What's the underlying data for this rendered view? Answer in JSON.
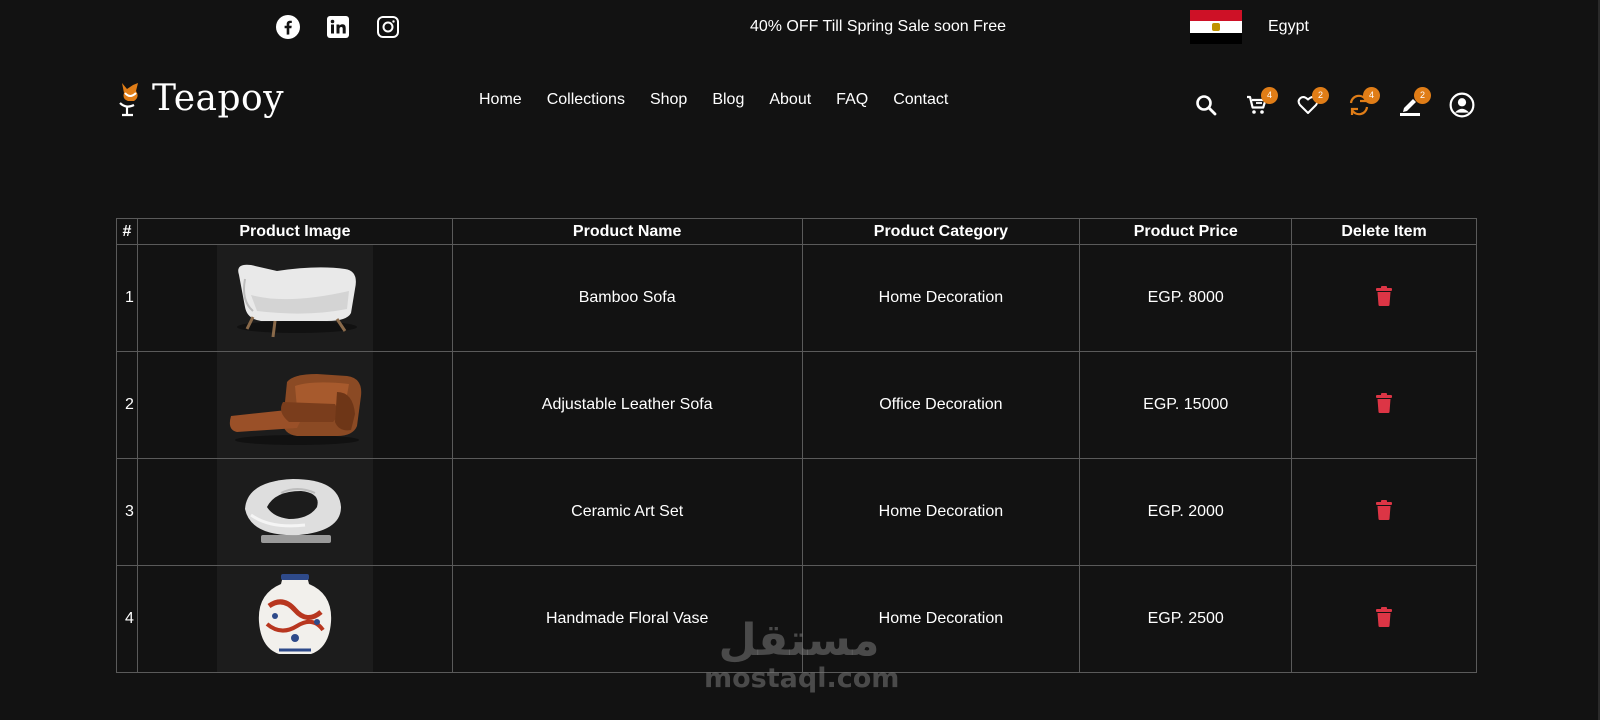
{
  "topbar": {
    "social": [
      "facebook-icon",
      "linkedin-icon",
      "instagram-icon"
    ],
    "promo": "40% OFF Till Spring Sale soon Free",
    "country": "Egypt"
  },
  "header": {
    "logo_text": "Teapoy",
    "nav": [
      "Home",
      "Collections",
      "Shop",
      "Blog",
      "About",
      "FAQ",
      "Contact"
    ],
    "icons": {
      "search": "search-icon",
      "cart": {
        "icon": "cart-icon",
        "count": "4"
      },
      "wishlist": {
        "icon": "heart-icon",
        "count": "2"
      },
      "compare": {
        "icon": "compare-icon",
        "count": "4"
      },
      "edit": {
        "icon": "edit-icon",
        "count": "2"
      },
      "account": "user-icon"
    },
    "accent_color": "#e07d17"
  },
  "table": {
    "headers": [
      "#",
      "Product Image",
      "Product Name",
      "Product Category",
      "Product Price",
      "Delete Item"
    ],
    "rows": [
      {
        "num": "1",
        "image": "white-armchair",
        "name": "Bamboo Sofa",
        "category": "Home Decoration",
        "price": "EGP. 8000"
      },
      {
        "num": "2",
        "image": "leather-recliner",
        "name": "Adjustable Leather Sofa",
        "category": "Office Decoration",
        "price": "EGP. 15000"
      },
      {
        "num": "3",
        "image": "ceramic-sculpture",
        "name": "Ceramic Art Set",
        "category": "Home Decoration",
        "price": "EGP. 2000"
      },
      {
        "num": "4",
        "image": "floral-vase",
        "name": "Handmade Floral Vase",
        "category": "Home Decoration",
        "price": "EGP. 2500"
      }
    ],
    "delete_color": "#dc3545"
  },
  "watermark": {
    "arabic": "مستقل",
    "latin": "mostaql.com"
  }
}
